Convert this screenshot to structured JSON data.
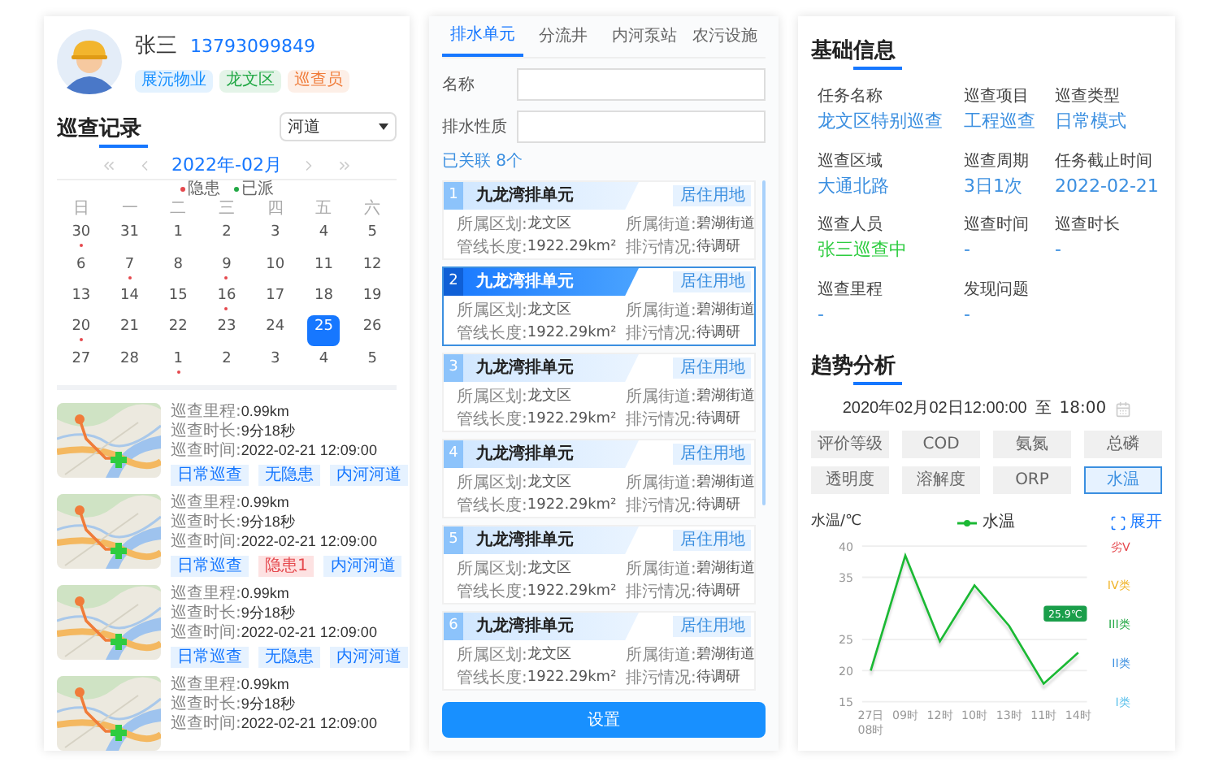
{
  "inspector": {
    "name": "张三",
    "phone": "13793099849",
    "tags": [
      {
        "text": "展沅物业",
        "color": "#1890ff"
      },
      {
        "text": "龙文区",
        "color": "#22a845"
      },
      {
        "text": "巡查员",
        "color": "#f07c3a"
      }
    ]
  },
  "records_section": {
    "title": "巡查记录",
    "filter": "河道"
  },
  "calendar": {
    "month": "2022年-02月",
    "legend": [
      {
        "text": "隐患",
        "color": "#e5484d"
      },
      {
        "text": "已派",
        "color": "#22a845"
      }
    ],
    "weekdays": [
      "日",
      "一",
      "二",
      "三",
      "四",
      "五",
      "六"
    ],
    "weeks": [
      [
        {
          "day": "30",
          "dot": true,
          "selected": false
        },
        {
          "day": "31",
          "dot": false,
          "selected": false
        },
        {
          "day": "1",
          "dot": false,
          "selected": false
        },
        {
          "day": "2",
          "dot": false,
          "selected": false
        },
        {
          "day": "3",
          "dot": false,
          "selected": false
        },
        {
          "day": "4",
          "dot": false,
          "selected": false
        },
        {
          "day": "5",
          "dot": false,
          "selected": false
        }
      ],
      [
        {
          "day": "6",
          "dot": false,
          "selected": false
        },
        {
          "day": "7",
          "dot": true,
          "selected": false
        },
        {
          "day": "8",
          "dot": false,
          "selected": false
        },
        {
          "day": "9",
          "dot": true,
          "selected": false
        },
        {
          "day": "10",
          "dot": false,
          "selected": false
        },
        {
          "day": "11",
          "dot": false,
          "selected": false
        },
        {
          "day": "12",
          "dot": false,
          "selected": false
        }
      ],
      [
        {
          "day": "13",
          "dot": false,
          "selected": false
        },
        {
          "day": "14",
          "dot": false,
          "selected": false
        },
        {
          "day": "15",
          "dot": false,
          "selected": false
        },
        {
          "day": "16",
          "dot": true,
          "selected": false
        },
        {
          "day": "17",
          "dot": false,
          "selected": false
        },
        {
          "day": "18",
          "dot": false,
          "selected": false
        },
        {
          "day": "19",
          "dot": false,
          "selected": false
        }
      ],
      [
        {
          "day": "20",
          "dot": true,
          "selected": false
        },
        {
          "day": "21",
          "dot": false,
          "selected": false
        },
        {
          "day": "22",
          "dot": false,
          "selected": false
        },
        {
          "day": "23",
          "dot": false,
          "selected": false
        },
        {
          "day": "24",
          "dot": false,
          "selected": false
        },
        {
          "day": "25",
          "dot": false,
          "selected": true
        },
        {
          "day": "26",
          "dot": false,
          "selected": false
        }
      ],
      [
        {
          "day": "27",
          "dot": false,
          "selected": false
        },
        {
          "day": "28",
          "dot": false,
          "selected": false
        },
        {
          "day": "1",
          "dot": true,
          "selected": false
        },
        {
          "day": "2",
          "dot": false,
          "selected": false
        },
        {
          "day": "3",
          "dot": false,
          "selected": false
        },
        {
          "day": "4",
          "dot": false,
          "selected": false
        },
        {
          "day": "5",
          "dot": false,
          "selected": false
        }
      ]
    ]
  },
  "records": [
    {
      "fields": [
        {
          "label": "巡查里程:",
          "value": "0.99km"
        },
        {
          "label": "巡查时长:",
          "value": "9分18秒"
        },
        {
          "label": "巡查时间:",
          "value": "2022-02-21 12:09:00"
        }
      ],
      "tags": [
        {
          "text": "日常巡查",
          "kind": "info"
        },
        {
          "text": "无隐患",
          "kind": "info"
        },
        {
          "text": "内河河道",
          "kind": "info"
        }
      ]
    },
    {
      "fields": [
        {
          "label": "巡查里程:",
          "value": "0.99km"
        },
        {
          "label": "巡查时长:",
          "value": "9分18秒"
        },
        {
          "label": "巡查时间:",
          "value": "2022-02-21 12:09:00"
        }
      ],
      "tags": [
        {
          "text": "日常巡查",
          "kind": "info"
        },
        {
          "text": "隐患1",
          "kind": "warning"
        },
        {
          "text": "内河河道",
          "kind": "info"
        }
      ]
    },
    {
      "fields": [
        {
          "label": "巡查里程:",
          "value": "0.99km"
        },
        {
          "label": "巡查时长:",
          "value": "9分18秒"
        },
        {
          "label": "巡查时间:",
          "value": "2022-02-21 12:09:00"
        }
      ],
      "tags": [
        {
          "text": "日常巡查",
          "kind": "info"
        },
        {
          "text": "无隐患",
          "kind": "info"
        },
        {
          "text": "内河河道",
          "kind": "info"
        }
      ]
    },
    {
      "fields": [
        {
          "label": "巡查里程:",
          "value": "0.99km"
        },
        {
          "label": "巡查时长:",
          "value": "9分18秒"
        },
        {
          "label": "巡查时间:",
          "value": "2022-02-21 12:09:00"
        }
      ]
    }
  ],
  "units_panel": {
    "tabs": [
      {
        "label": "排水单元",
        "selected": true
      },
      {
        "label": "分流井",
        "selected": false
      },
      {
        "label": "内河泵站",
        "selected": false
      },
      {
        "label": "农污设施",
        "selected": false
      }
    ],
    "fields": [
      {
        "label": "名称"
      },
      {
        "label": "排水性质"
      }
    ],
    "linked_count": "已关联 8个",
    "units": [
      {
        "number": "1",
        "name": "九龙湾排单元",
        "badge": "居住用地",
        "selected": false,
        "fields": [
          {
            "label": "所属区划:",
            "value": "龙文区"
          },
          {
            "label": "所属街道:",
            "value": "碧湖街道"
          },
          {
            "label": "管线长度:",
            "value": "1922.29km²"
          },
          {
            "label": "排污情况:",
            "value": "待调研"
          }
        ]
      },
      {
        "number": "2",
        "name": "九龙湾排单元",
        "badge": "居住用地",
        "selected": true,
        "fields": [
          {
            "label": "所属区划:",
            "value": "龙文区"
          },
          {
            "label": "所属街道:",
            "value": "碧湖街道"
          },
          {
            "label": "管线长度:",
            "value": "1922.29km²"
          },
          {
            "label": "排污情况:",
            "value": "待调研"
          }
        ]
      },
      {
        "number": "3",
        "name": "九龙湾排单元",
        "badge": "居住用地",
        "selected": false,
        "fields": [
          {
            "label": "所属区划:",
            "value": "龙文区"
          },
          {
            "label": "所属街道:",
            "value": "碧湖街道"
          },
          {
            "label": "管线长度:",
            "value": "1922.29km²"
          },
          {
            "label": "排污情况:",
            "value": "待调研"
          }
        ]
      },
      {
        "number": "4",
        "name": "九龙湾排单元",
        "badge": "居住用地",
        "selected": false,
        "fields": [
          {
            "label": "所属区划:",
            "value": "龙文区"
          },
          {
            "label": "所属街道:",
            "value": "碧湖街道"
          },
          {
            "label": "管线长度:",
            "value": "1922.29km²"
          },
          {
            "label": "排污情况:",
            "value": "待调研"
          }
        ]
      },
      {
        "number": "5",
        "name": "九龙湾排单元",
        "badge": "居住用地",
        "selected": false,
        "fields": [
          {
            "label": "所属区划:",
            "value": "龙文区"
          },
          {
            "label": "所属街道:",
            "value": "碧湖街道"
          },
          {
            "label": "管线长度:",
            "value": "1922.29km²"
          },
          {
            "label": "排污情况:",
            "value": "待调研"
          }
        ]
      },
      {
        "number": "6",
        "name": "九龙湾排单元",
        "badge": "居住用地",
        "selected": false,
        "fields": [
          {
            "label": "所属区划:",
            "value": "龙文区"
          },
          {
            "label": "所属街道:",
            "value": "碧湖街道"
          },
          {
            "label": "管线长度:",
            "value": "1922.29km²"
          },
          {
            "label": "排污情况:",
            "value": "待调研"
          }
        ]
      }
    ],
    "button": "设置"
  },
  "basic_info": {
    "title": "基础信息",
    "items": [
      {
        "label": "任务名称",
        "value": "龙文区特别巡查",
        "kind": "link"
      },
      {
        "label": "巡查项目",
        "value": "工程巡查",
        "kind": "link"
      },
      {
        "label": "巡查类型",
        "value": "日常模式",
        "kind": "link"
      },
      {
        "label": "巡查区域",
        "value": "大通北路",
        "kind": "link"
      },
      {
        "label": "巡查周期",
        "value": "3日1次",
        "kind": "link"
      },
      {
        "label": "任务截止时间",
        "value": "2022-02-21",
        "kind": "link"
      },
      {
        "label": "巡查人员",
        "value": "张三巡查中",
        "kind": "active"
      },
      {
        "label": "巡查时间",
        "value": "-",
        "kind": "link"
      },
      {
        "label": "巡查时长",
        "value": "-",
        "kind": "link"
      },
      {
        "label": "巡查里程",
        "value": "-",
        "kind": "link"
      },
      {
        "label": "发现问题",
        "value": "-",
        "kind": "link"
      }
    ]
  },
  "trend": {
    "title": "趋势分析",
    "start": "2020年02月02日12:00:00",
    "separator": "至",
    "end": "18:00",
    "metrics": [
      {
        "label": "评价等级",
        "selected": false
      },
      {
        "label": "COD",
        "selected": false
      },
      {
        "label": "氨氮",
        "selected": false
      },
      {
        "label": "总磷",
        "selected": false
      },
      {
        "label": "透明度",
        "selected": false
      },
      {
        "label": "溶解度",
        "selected": false
      },
      {
        "label": "ORP",
        "selected": false
      },
      {
        "label": "水温",
        "selected": true
      }
    ],
    "expand": "展开",
    "grades": [
      {
        "text": "劣V",
        "color": "#e5484d"
      },
      {
        "text": "IV类",
        "color": "#f0b429"
      },
      {
        "text": "III类",
        "color": "#22a845"
      },
      {
        "text": "II类",
        "color": "#3b8fe0"
      },
      {
        "text": "I类",
        "color": "#5bc0eb"
      }
    ],
    "chart_data": {
      "type": "line",
      "ylabel": "水温/℃",
      "categories": [
        "27日\n08时",
        "09时",
        "12时",
        "10时",
        "13时",
        "11时",
        "14时"
      ],
      "series": [
        {
          "name": "水温",
          "color": "#1bb934",
          "values": [
            20,
            38.5,
            24.7,
            33.7,
            27.2,
            17.9,
            22.9
          ]
        }
      ],
      "yticks": [
        40,
        35,
        25,
        20,
        15
      ],
      "ylim": [
        15,
        40
      ],
      "grid": true,
      "annotations": [
        {
          "text": "25.9℃"
        }
      ]
    }
  }
}
